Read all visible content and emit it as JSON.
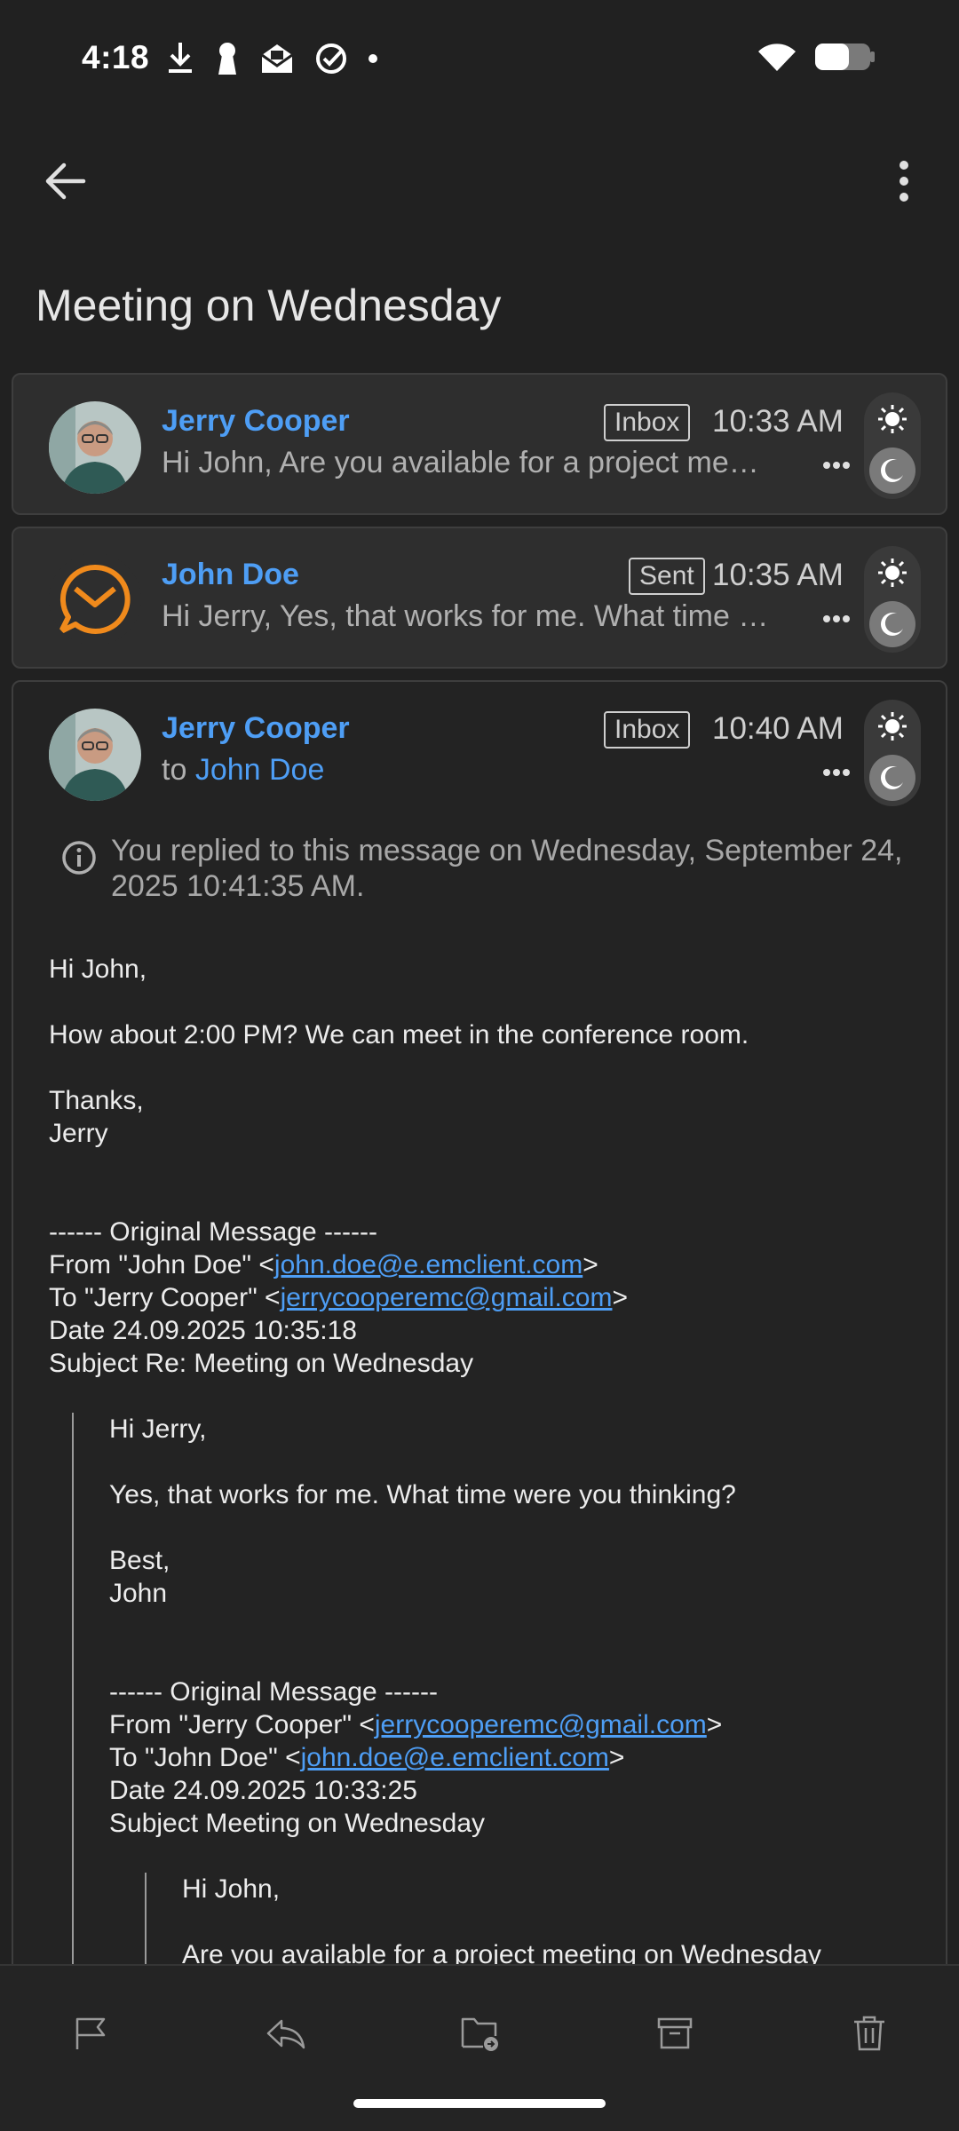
{
  "status_bar": {
    "time": "4:18"
  },
  "app_bar": {
    "back": "Back",
    "more": "More options"
  },
  "subject": "Meeting on Wednesday",
  "messages": [
    {
      "sender": "Jerry Cooper",
      "folder": "Inbox",
      "time": "10:33 AM",
      "preview": "Hi John, Are you available for a project meeting on Wednesday?"
    },
    {
      "sender": "John Doe",
      "folder": "Sent",
      "time": "10:35 AM",
      "preview": "Hi Jerry, Yes, that works for me. What time were you thinking?"
    },
    {
      "sender": "Jerry Cooper",
      "folder": "Inbox",
      "time": "10:40 AM",
      "to_prefix": "to",
      "to_name": "John Doe"
    }
  ],
  "info_text": "You replied to this message on Wednesday, September 24, 2025 10:41:35 AM.",
  "body": {
    "greeting": "Hi John,",
    "line1": "How about 2:00 PM? We can meet in the conference room.",
    "thanks": "Thanks,",
    "sign": "Jerry",
    "orig1_header": "------ Original Message ------",
    "orig1_from_pre": "From \"John Doe\" <",
    "orig1_from_email": "john.doe@e.emclient.com",
    "orig1_to_pre": "To \"Jerry Cooper\" <",
    "orig1_to_email": "jerrycooperemc@gmail.com",
    "orig1_date": "Date 24.09.2025 10:35:18",
    "orig1_subject": "Subject Re: Meeting on Wednesday",
    "q1_greeting": "Hi Jerry,",
    "q1_line1": "Yes, that works for me. What time were you thinking?",
    "q1_best": "Best,",
    "q1_sign": "John",
    "orig2_header": "------ Original Message ------",
    "orig2_from_pre": "From \"Jerry Cooper\" <",
    "orig2_from_email": "jerrycooperemc@gmail.com",
    "orig2_to_pre": "To \"John Doe\" <",
    "orig2_to_email": "john.doe@e.emclient.com",
    "orig2_date": "Date 24.09.2025 10:33:25",
    "orig2_subject": "Subject Meeting on Wednesday",
    "q2_greeting": "Hi John,",
    "q2_line1": "Are you available for a project meeting on Wednesday"
  },
  "bracket_close": ">",
  "colors": {
    "accent": "#4e9ef5",
    "background": "#212121",
    "card": "#2e2e2e",
    "emclient_orange": "#f08a1c"
  },
  "bottom_bar": [
    "flag-icon",
    "reply-icon",
    "move-folder-icon",
    "archive-icon",
    "delete-icon"
  ]
}
